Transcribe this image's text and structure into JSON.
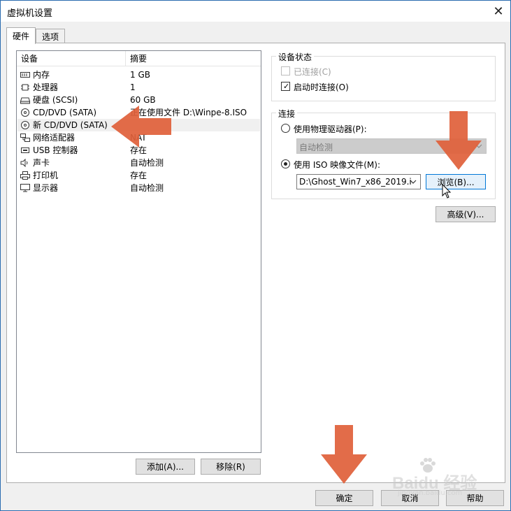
{
  "window": {
    "title": "虚拟机设置"
  },
  "tabs": [
    {
      "label": "硬件"
    },
    {
      "label": "选项"
    }
  ],
  "device_table": {
    "columns": [
      "设备",
      "摘要"
    ],
    "rows": [
      {
        "name": "内存",
        "summary": "1 GB",
        "icon": "memory-icon"
      },
      {
        "name": "处理器",
        "summary": "1",
        "icon": "cpu-icon"
      },
      {
        "name": "硬盘 (SCSI)",
        "summary": "60 GB",
        "icon": "harddisk-icon"
      },
      {
        "name": "CD/DVD (SATA)",
        "summary": "正在使用文件 D:\\Winpe-8.ISO",
        "icon": "cd-icon"
      },
      {
        "name": "新 CD/DVD (SATA)",
        "summary": "",
        "icon": "cd-icon"
      },
      {
        "name": "网络适配器",
        "summary": "NAT",
        "icon": "network-icon"
      },
      {
        "name": "USB 控制器",
        "summary": "存在",
        "icon": "usb-icon"
      },
      {
        "name": "声卡",
        "summary": "自动检测",
        "icon": "sound-icon"
      },
      {
        "name": "打印机",
        "summary": "存在",
        "icon": "printer-icon"
      },
      {
        "name": "显示器",
        "summary": "自动检测",
        "icon": "monitor-icon"
      }
    ]
  },
  "list_buttons": {
    "add": "添加(A)...",
    "remove": "移除(R)"
  },
  "device_status": {
    "title": "设备状态",
    "connected": {
      "label": "已连接(C)",
      "checked": false,
      "enabled": false
    },
    "connect_on_power_on": {
      "label": "启动时连接(O)",
      "checked": true
    }
  },
  "connection": {
    "title": "连接",
    "physical_drive": {
      "label": "使用物理驱动器(P):",
      "selected": false
    },
    "physical_drive_value": "自动检测",
    "iso_image": {
      "label": "使用 ISO 映像文件(M):",
      "selected": true
    },
    "iso_path": "D:\\Ghost_Win7_x86_2019.i",
    "browse_button": "浏览(B)..."
  },
  "advanced_button": "高级(V)...",
  "footer": {
    "ok": "确定",
    "cancel": "取消",
    "help": "帮助"
  },
  "watermark": "Baidu 经验",
  "watermark_url": "jingyan.baidu.com",
  "colors": {
    "annotation_arrow": "#e0603a",
    "accent": "#0078d7",
    "window_border": "#2b6cb0"
  }
}
